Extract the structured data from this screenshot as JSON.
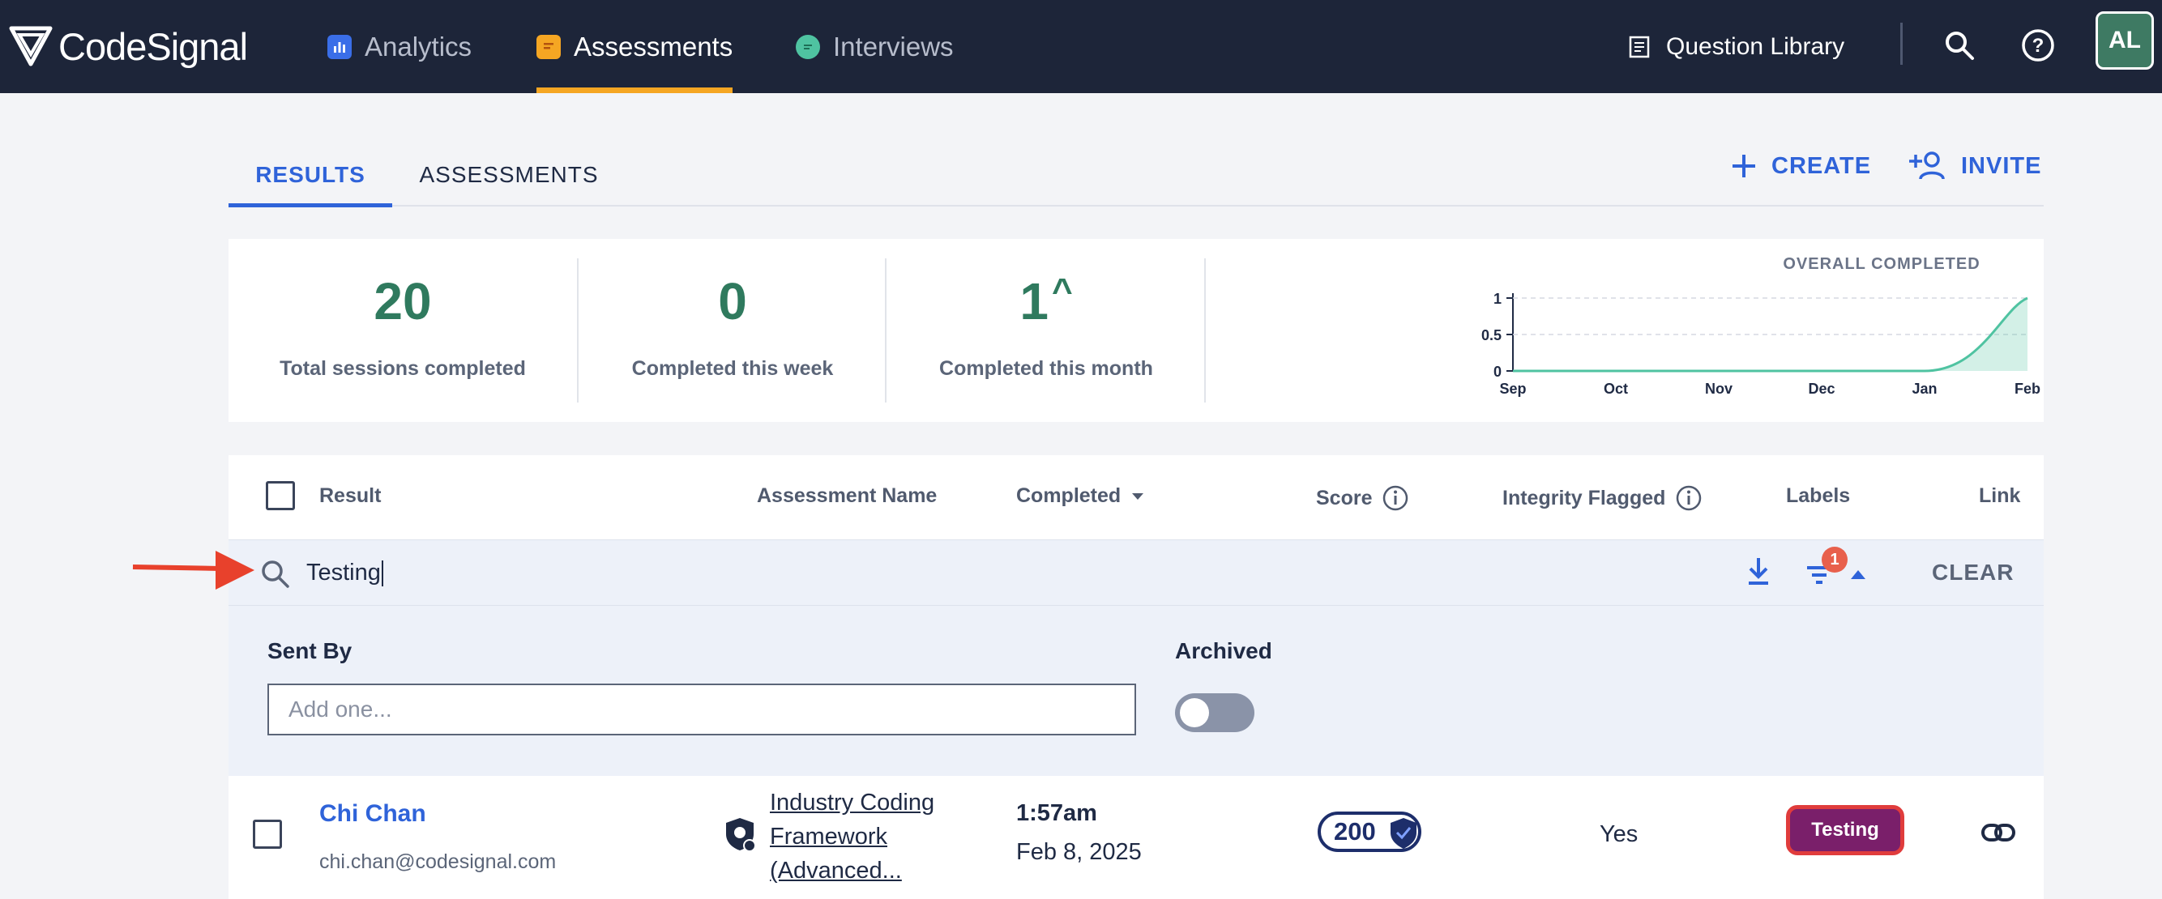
{
  "app": {
    "logo_text": "CodeSignal",
    "nav_tabs": [
      {
        "label": "Analytics",
        "icon": "analytics-icon"
      },
      {
        "label": "Assessments",
        "icon": "assessments-icon",
        "active": true
      },
      {
        "label": "Interviews",
        "icon": "interviews-icon"
      }
    ],
    "question_library_label": "Question Library",
    "avatar_initials": "AL"
  },
  "subtabs": [
    {
      "label": "RESULTS",
      "active": true
    },
    {
      "label": "ASSESSMENTS",
      "active": false
    }
  ],
  "actions": {
    "create_label": "CREATE",
    "invite_label": "INVITE"
  },
  "stats": [
    {
      "value": "20",
      "label": "Total sessions completed"
    },
    {
      "value": "0",
      "label": "Completed this week"
    },
    {
      "value": "1",
      "trend": "^",
      "label": "Completed this month"
    }
  ],
  "chart_data": {
    "type": "area",
    "title": "OVERALL COMPLETED",
    "x": [
      "Sep",
      "Oct",
      "Nov",
      "Dec",
      "Jan",
      "Feb"
    ],
    "y_ticks": [
      "0",
      "0.5",
      "1"
    ],
    "ylim": [
      0,
      1
    ],
    "series": [
      {
        "values": [
          0,
          0,
          0,
          0,
          0,
          1
        ]
      }
    ],
    "grid": true,
    "color": "#4fc3a1"
  },
  "table": {
    "headers": {
      "result": "Result",
      "assessment_name": "Assessment Name",
      "completed": "Completed",
      "score": "Score",
      "integrity_flagged": "Integrity Flagged",
      "labels": "Labels",
      "link": "Link"
    },
    "search_value": "Testing",
    "filter_count": "1",
    "clear_label": "CLEAR",
    "filters": {
      "sent_by_label": "Sent By",
      "sent_by_placeholder": "Add one...",
      "archived_label": "Archived"
    },
    "rows": [
      {
        "name": "Chi Chan",
        "email": "chi.chan@codesignal.com",
        "assessment_name": "Industry Coding Framework (Advanced...",
        "completed_time": "1:57am",
        "completed_date": "Feb 8, 2025",
        "score": "200",
        "integrity_flagged": "Yes",
        "label": "Testing"
      }
    ]
  },
  "colors": {
    "nav_bg": "#1d2539",
    "accent_blue": "#2f63d9",
    "accent_orange": "#f5a623",
    "stat_green": "#2f7a5e",
    "label_purple": "#7a1f6a",
    "highlight_red": "#e03c3c"
  }
}
